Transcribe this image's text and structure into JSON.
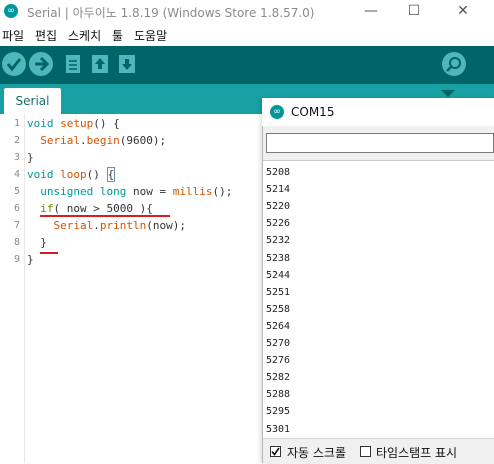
{
  "window": {
    "title": "Serial | 아두이노 1.8.19 (Windows Store 1.8.57.0)",
    "logo_glyph": "∞",
    "minimize_glyph": "—",
    "maximize_glyph": "☐",
    "close_glyph": "✕"
  },
  "menu": [
    "파일",
    "편집",
    "스케치",
    "툴",
    "도움말"
  ],
  "toolbar": {
    "verify_icon": "check-icon",
    "upload_icon": "arrow-right-icon",
    "new_icon": "file-icon",
    "open_icon": "arrow-up-icon",
    "save_icon": "arrow-down-icon",
    "serial_monitor_icon": "magnifier-icon"
  },
  "tabs": [
    {
      "label": "Serial"
    }
  ],
  "editor": {
    "line_numbers": [
      "1",
      "2",
      "3",
      "4",
      "5",
      "6",
      "7",
      "8",
      "9"
    ]
  },
  "serial_monitor": {
    "title": "COM15",
    "input_value": "",
    "output": [
      "5208",
      "5214",
      "5220",
      "5226",
      "5232",
      "5238",
      "5244",
      "5251",
      "5258",
      "5264",
      "5270",
      "5276",
      "5282",
      "5288",
      "5295",
      "5301"
    ],
    "autoscroll_label": "자동 스크롤",
    "autoscroll_checked": true,
    "timestamp_label": "타임스탬프 표시",
    "timestamp_checked": false
  },
  "colors": {
    "toolbar": "#006468",
    "tabstrip": "#17a1a5",
    "accent": "#4db7bb",
    "annotation_red": "#d62020"
  }
}
